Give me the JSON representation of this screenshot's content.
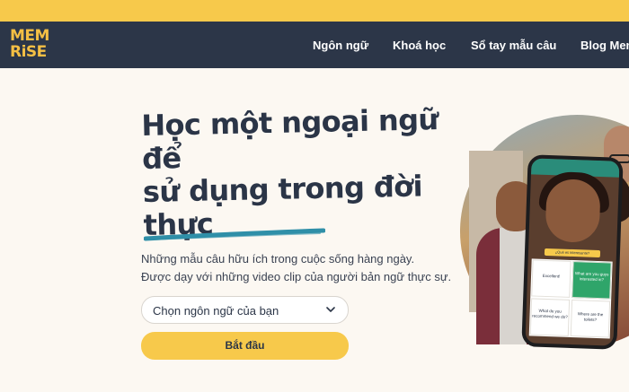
{
  "brand": {
    "line1": "MEM",
    "line2": "RiSE",
    "color": "#f4bf44"
  },
  "nav": {
    "items": [
      "Ngôn ngữ",
      "Khoá học",
      "Sổ tay mẫu câu",
      "Blog Mem"
    ]
  },
  "hero": {
    "headline_line1": "Học một ngoại ngữ để",
    "headline_line2": "sử dụng trong đời",
    "headline_line3": "thực",
    "subtitle_line1": "Những mẫu câu hữu ích trong cuộc sống hàng ngày.",
    "subtitle_line2": "Được dạy với những video clip của người bản ngữ thực sự."
  },
  "language_select": {
    "placeholder": "Chọn ngôn ngữ của bạn"
  },
  "start_button": {
    "label": "Bắt đầu"
  },
  "phone": {
    "prompt": "¿Qué es interesante?",
    "options": [
      "Excellent!",
      "What are you guys interested in?",
      "What do you recommend we do?",
      "Where are the toilets?"
    ]
  },
  "colors": {
    "accent": "#f7c94b",
    "nav_bg": "#2c3648",
    "page_bg": "#fcf8f2",
    "underline": "#2f8fa8"
  }
}
